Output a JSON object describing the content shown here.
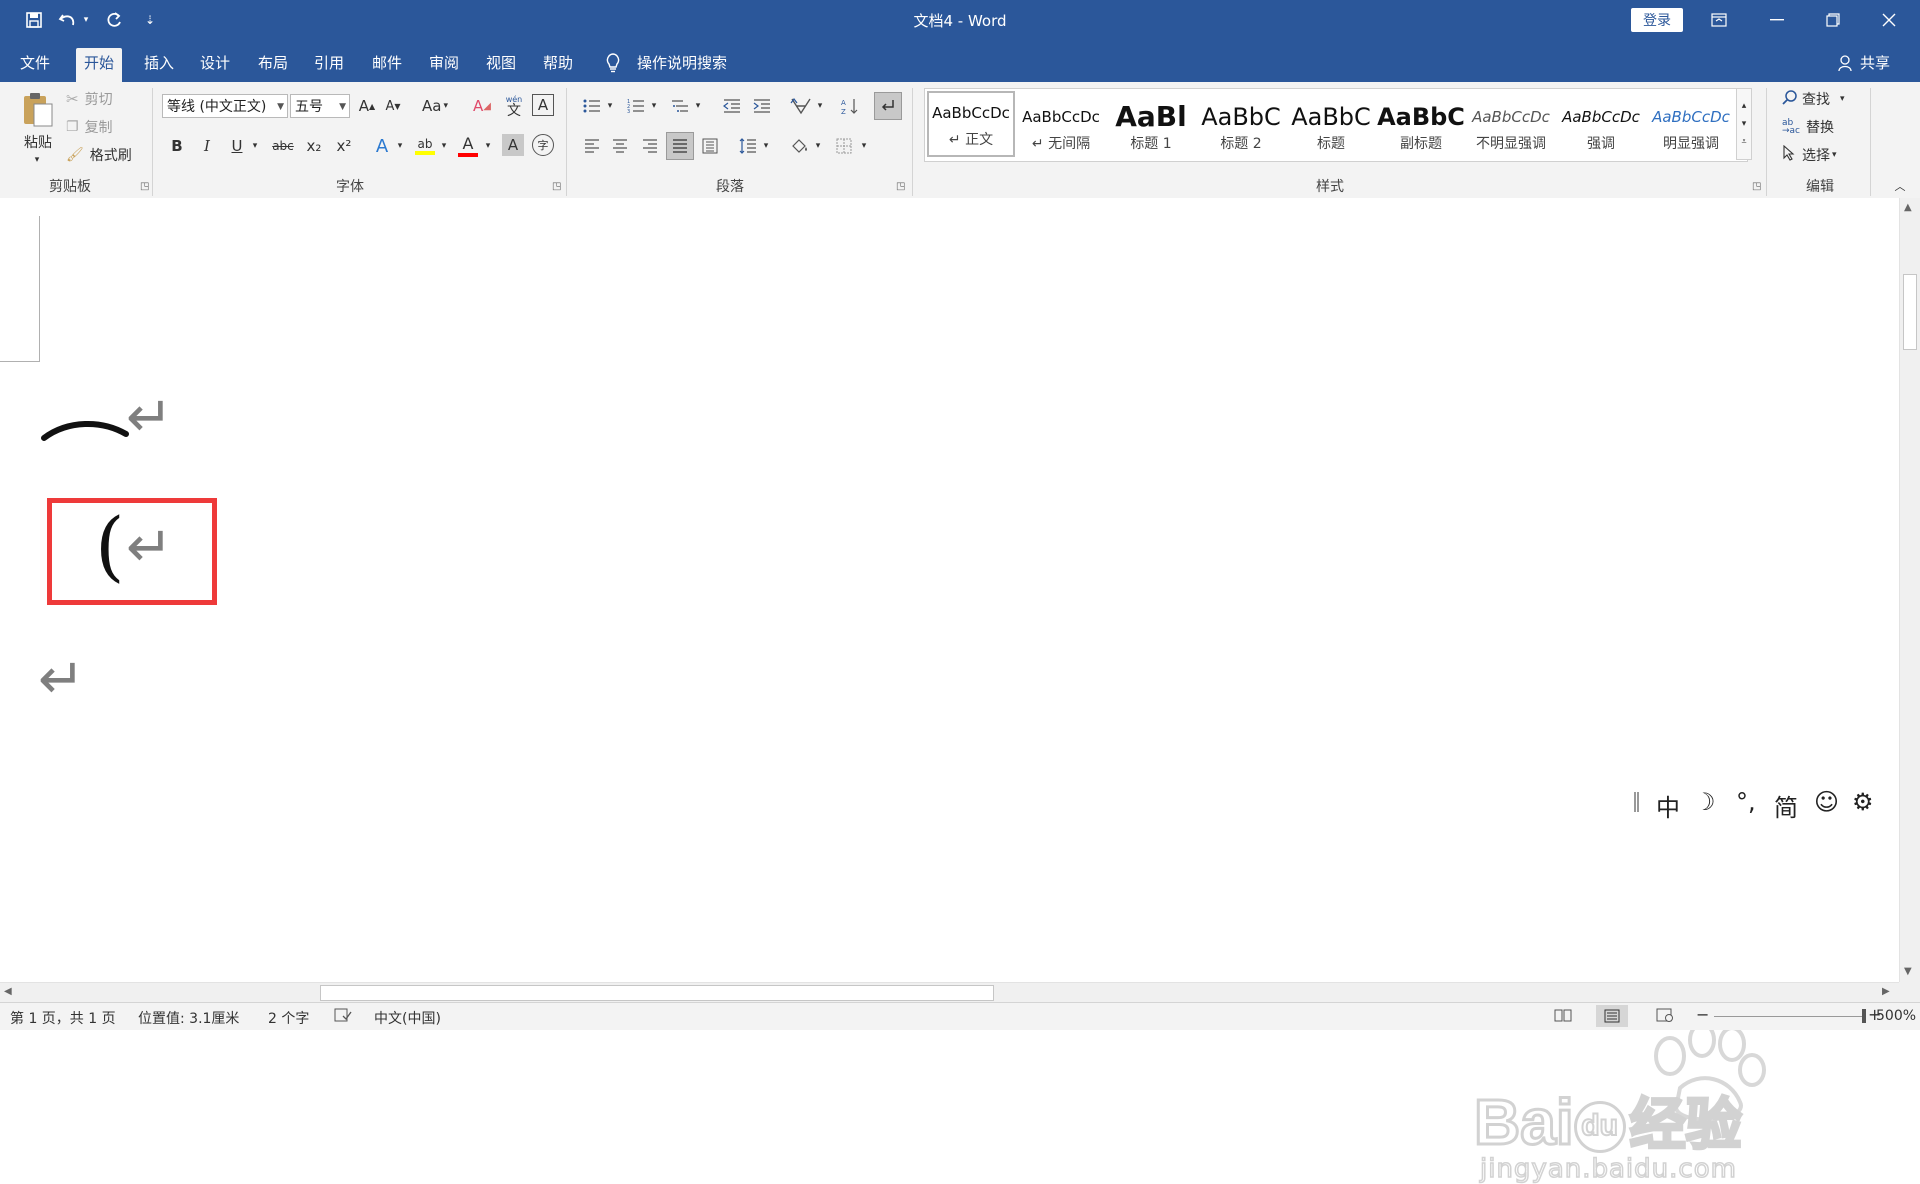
{
  "titlebar": {
    "doc_title": "文档4  -  Word",
    "signin_label": "登录",
    "quick_access": {
      "customize": "⇣"
    }
  },
  "tabs": [
    {
      "label": "文件",
      "active": false
    },
    {
      "label": "开始",
      "active": true
    },
    {
      "label": "插入",
      "active": false
    },
    {
      "label": "设计",
      "active": false
    },
    {
      "label": "布局",
      "active": false
    },
    {
      "label": "引用",
      "active": false
    },
    {
      "label": "邮件",
      "active": false
    },
    {
      "label": "审阅",
      "active": false
    },
    {
      "label": "视图",
      "active": false
    },
    {
      "label": "帮助",
      "active": false
    }
  ],
  "tell_me": "操作说明搜索",
  "share_label": "共享",
  "ribbon": {
    "clipboard": {
      "label": "剪贴板",
      "paste": "粘贴",
      "cut": "剪切",
      "copy": "复制",
      "format_painter": "格式刷"
    },
    "font": {
      "label": "字体",
      "font_name": "等线 (中文正文)",
      "font_size": "五号",
      "change_case": "Aa",
      "phonetic": "wén",
      "phonetic_char": "文",
      "bold": "B",
      "italic": "I",
      "underline": "U",
      "strike": "abc",
      "subscript": "x₂",
      "superscript": "x²",
      "grow": "A",
      "shrink": "A",
      "border_char": "A",
      "shading_char": "A",
      "highlight_char": "ab",
      "color_char": "A",
      "enclose_char": "字",
      "highlight_color": "#ffff00",
      "font_color": "#ff0000"
    },
    "paragraph": {
      "label": "段落"
    },
    "styles": {
      "label": "样式",
      "items": [
        {
          "preview": "AaBbCcDc",
          "name": "↵ 正文"
        },
        {
          "preview": "AaBbCcDc",
          "name": "↵ 无间隔"
        },
        {
          "preview": "AaBl",
          "name": "标题 1"
        },
        {
          "preview": "AaBbC",
          "name": "标题 2"
        },
        {
          "preview": "AaBbC",
          "name": "标题"
        },
        {
          "preview": "AaBbC",
          "name": "副标题"
        },
        {
          "preview": "AaBbCcDc",
          "name": "不明显强调"
        },
        {
          "preview": "AaBbCcDc",
          "name": "强调"
        },
        {
          "preview": "AaBbCcDc",
          "name": "明显强调"
        }
      ]
    },
    "editing": {
      "label": "编辑",
      "find": "查找",
      "replace": "替换",
      "select": "选择"
    }
  },
  "document": {
    "line1_text": "⌒",
    "line2_text": "(",
    "para_mark": "↵",
    "highlight_color": "#ee3a3a"
  },
  "ime": {
    "mode": "中",
    "punct": "°,",
    "charset": "简"
  },
  "status": {
    "page": "第 1 页，共 1 页",
    "position": "位置值: 3.1厘米",
    "words": "2 个字",
    "language": "中文(中国)",
    "zoom": "500%"
  },
  "watermark": {
    "brand": "Bai",
    "brand2": "du",
    "brand_cn": "经验",
    "url": "jingyan.baidu.com"
  }
}
